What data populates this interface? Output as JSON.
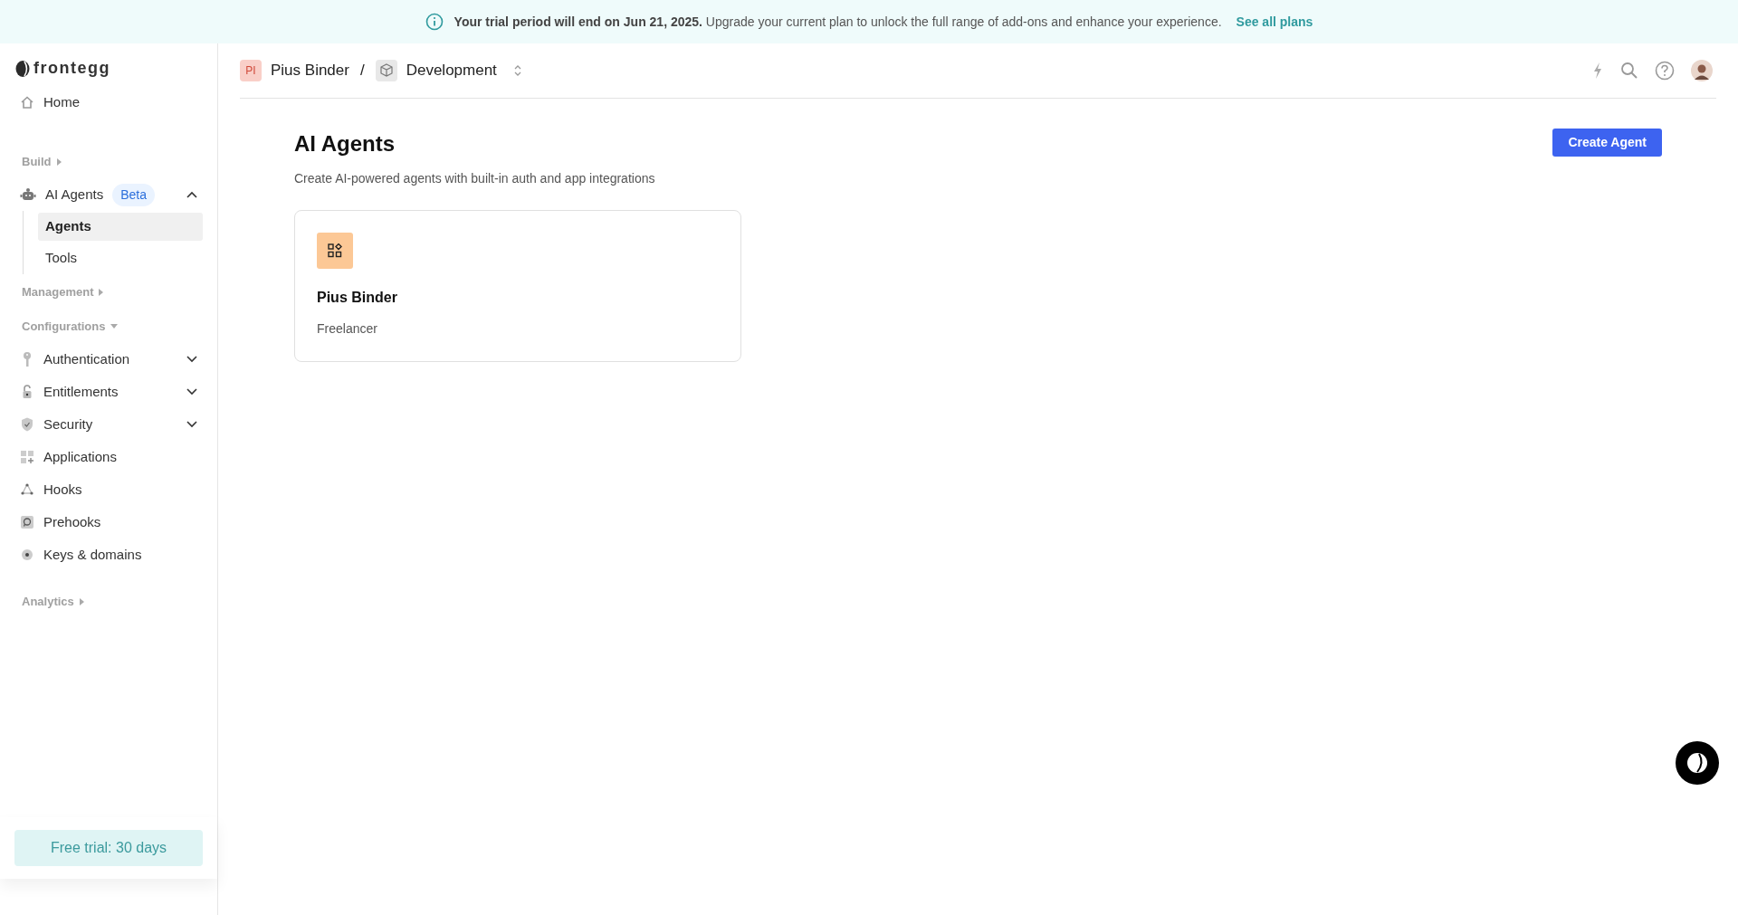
{
  "banner": {
    "bold": "Your trial period will end on Jun 21, 2025.",
    "text": "Upgrade your current plan to unlock the full range of add-ons and enhance your experience.",
    "link": "See all plans"
  },
  "sidebar": {
    "logo": "frontegg",
    "items": [
      {
        "kind": "link",
        "label": "Home"
      },
      {
        "kind": "section",
        "label": "Build",
        "expanded": false
      },
      {
        "kind": "nav",
        "label": "AI Agents",
        "badge": "Beta",
        "expandable": true,
        "expanded": true,
        "children": [
          {
            "label": "Agents",
            "selected": true
          },
          {
            "label": "Tools",
            "selected": false
          }
        ]
      },
      {
        "kind": "section",
        "label": "Management",
        "expanded": false
      },
      {
        "kind": "section",
        "label": "Configurations",
        "expanded": true
      },
      {
        "kind": "nav",
        "label": "Authentication",
        "expandable": true,
        "expanded": false
      },
      {
        "kind": "nav",
        "label": "Entitlements",
        "expandable": true,
        "expanded": false
      },
      {
        "kind": "nav",
        "label": "Security",
        "expandable": true,
        "expanded": false
      },
      {
        "kind": "nav",
        "label": "Applications",
        "expandable": false
      },
      {
        "kind": "nav",
        "label": "Hooks",
        "expandable": false
      },
      {
        "kind": "nav",
        "label": "Prehooks",
        "expandable": false
      },
      {
        "kind": "nav",
        "label": "Keys & domains",
        "expandable": false
      },
      {
        "kind": "section",
        "label": "Analytics",
        "expanded": false
      }
    ],
    "trial": "Free trial: 30 days"
  },
  "breadcrumb": {
    "account_initials": "PI",
    "account": "Pius Binder",
    "separator": "/",
    "environment": "Development"
  },
  "page": {
    "title": "AI Agents",
    "subtitle": "Create AI-powered agents with built-in auth and app integrations",
    "action": "Create Agent"
  },
  "agents": [
    {
      "name": "Pius Binder",
      "role": "Freelancer"
    }
  ]
}
